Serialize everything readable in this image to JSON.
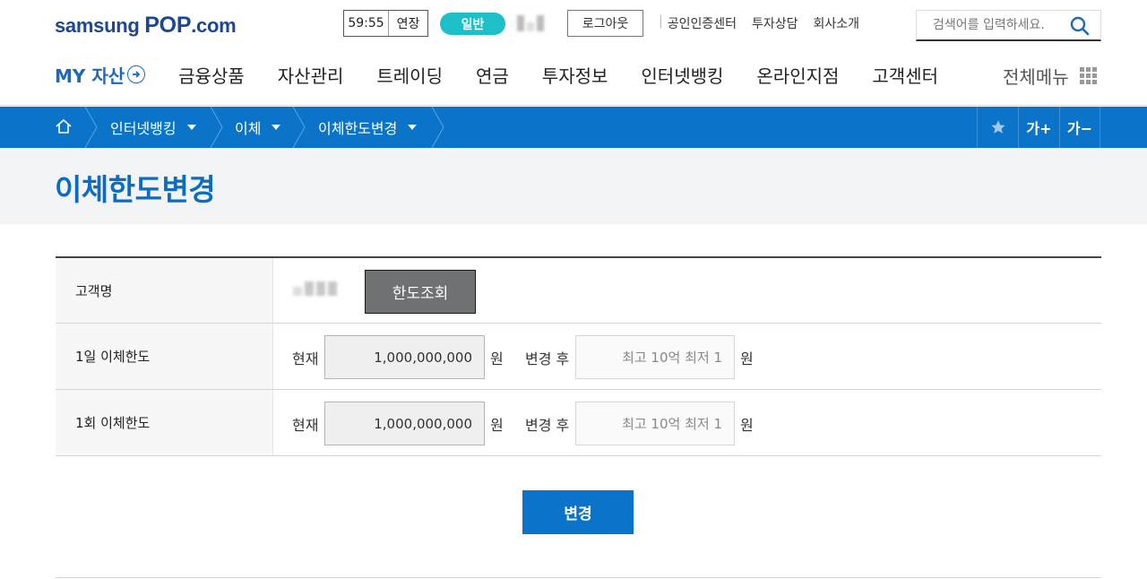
{
  "header": {
    "logo_prefix": "samsung ",
    "logo_pop": "POP",
    "logo_suffix": ".com",
    "session_timer": "59:55",
    "extend_label": "연장",
    "grade_badge": "일반",
    "logout_label": "로그아웃",
    "top_links": [
      "공인인증센터",
      "투자상담",
      "회사소개"
    ],
    "search_placeholder": "검색어를 입력하세요."
  },
  "gnb": {
    "my_assets": "MY 자산",
    "items": [
      "금융상품",
      "자산관리",
      "트레이딩",
      "연금",
      "투자정보",
      "인터넷뱅킹",
      "온라인지점",
      "고객센터"
    ],
    "all_menu": "전체메뉴"
  },
  "breadcrumb": {
    "items": [
      "인터넷뱅킹",
      "이체",
      "이체한도변경"
    ],
    "font_increase": "가+",
    "font_decrease": "가−"
  },
  "page": {
    "title": "이체한도변경"
  },
  "form": {
    "customer_label": "고객명",
    "limit_inquiry_button": "한도조회",
    "rows": [
      {
        "label": "1일 이체한도",
        "current_label": "현재",
        "current_value": "1,000,000,000",
        "unit": "원",
        "after_label": "변경 후",
        "after_placeholder": "최고 10억 최저 1"
      },
      {
        "label": "1회 이체한도",
        "current_label": "현재",
        "current_value": "1,000,000,000",
        "unit": "원",
        "after_label": "변경 후",
        "after_placeholder": "최고 10억 최저 1"
      }
    ],
    "submit_button": "변경"
  },
  "colors": {
    "primary": "#0b74c9",
    "title": "#0b6cc2",
    "logo": "#1d4694",
    "badge": "#1dbfc9",
    "inquiry_button": "#6f7173"
  }
}
